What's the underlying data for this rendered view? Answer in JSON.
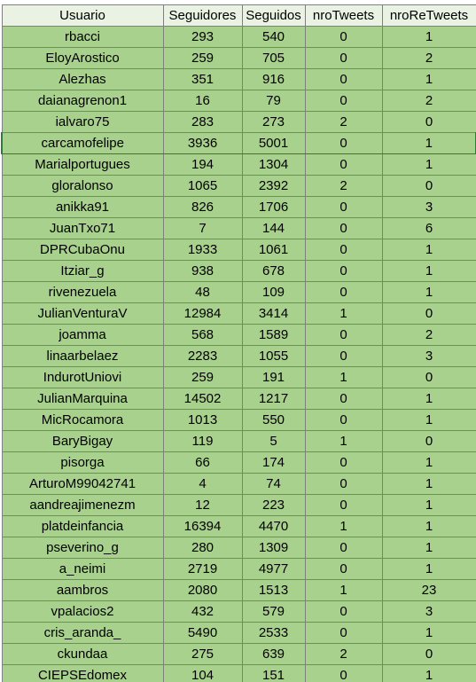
{
  "table": {
    "headers": [
      "Usuario",
      "Seguidores",
      "Seguidos",
      "nroTweets",
      "nroReTweets"
    ],
    "rows": [
      [
        "rbacci",
        "293",
        "540",
        "0",
        "1"
      ],
      [
        "EloyArostico",
        "259",
        "705",
        "0",
        "2"
      ],
      [
        "Alezhas",
        "351",
        "916",
        "0",
        "1"
      ],
      [
        "daianagrenon1",
        "16",
        "79",
        "0",
        "2"
      ],
      [
        "ialvaro75",
        "283",
        "273",
        "2",
        "0"
      ],
      [
        "carcamofelipe",
        "3936",
        "5001",
        "0",
        "1"
      ],
      [
        "Marialportugues",
        "194",
        "1304",
        "0",
        "1"
      ],
      [
        "gloralonso",
        "1065",
        "2392",
        "2",
        "0"
      ],
      [
        "anikka91",
        "826",
        "1706",
        "0",
        "3"
      ],
      [
        "JuanTxo71",
        "7",
        "144",
        "0",
        "6"
      ],
      [
        "DPRCubaOnu",
        "1933",
        "1061",
        "0",
        "1"
      ],
      [
        "Itziar_g",
        "938",
        "678",
        "0",
        "1"
      ],
      [
        "rivenezuela",
        "48",
        "109",
        "0",
        "1"
      ],
      [
        "JulianVenturaV",
        "12984",
        "3414",
        "1",
        "0"
      ],
      [
        "joamma",
        "568",
        "1589",
        "0",
        "2"
      ],
      [
        "linaarbelaez",
        "2283",
        "1055",
        "0",
        "3"
      ],
      [
        "IndurotUniovi",
        "259",
        "191",
        "1",
        "0"
      ],
      [
        "JulianMarquina",
        "14502",
        "1217",
        "0",
        "1"
      ],
      [
        "MicRocamora",
        "1013",
        "550",
        "0",
        "1"
      ],
      [
        "BaryBigay",
        "119",
        "5",
        "1",
        "0"
      ],
      [
        "pisorga",
        "66",
        "174",
        "0",
        "1"
      ],
      [
        "ArturoM99042741",
        "4",
        "74",
        "0",
        "1"
      ],
      [
        "aandreajimenezm",
        "12",
        "223",
        "0",
        "1"
      ],
      [
        "platdeinfancia",
        "16394",
        "4470",
        "1",
        "1"
      ],
      [
        "pseverino_g",
        "280",
        "1309",
        "0",
        "1"
      ],
      [
        "a_neimi",
        "2719",
        "4977",
        "0",
        "1"
      ],
      [
        "aambros",
        "2080",
        "1513",
        "1",
        "23"
      ],
      [
        "vpalacios2",
        "432",
        "579",
        "0",
        "3"
      ],
      [
        "cris_aranda_",
        "5490",
        "2533",
        "0",
        "1"
      ],
      [
        "ckundaa",
        "275",
        "639",
        "2",
        "0"
      ],
      [
        "CIEPSEdomex",
        "104",
        "151",
        "0",
        "1"
      ]
    ]
  },
  "colors": {
    "header_bg": "#e9f2e3",
    "cell_bg": "#a9d18e",
    "grid_line": "#7f7f7f",
    "active_row_border": "#2e7d32"
  }
}
